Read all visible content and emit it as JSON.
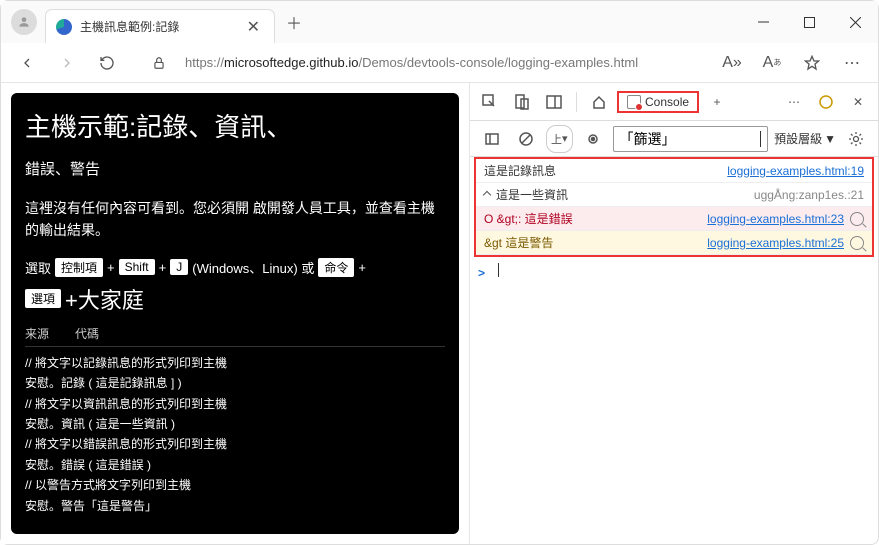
{
  "window": {
    "tab_title": "主機訊息範例:記錄",
    "url_prefix": "https://",
    "url_host": "microsoftedge.github.io",
    "url_path": "/Demos/devtools-console/logging-examples.html"
  },
  "page": {
    "h1": "主機示範:記錄、資訊、",
    "h2": "錯誤、警告",
    "para": "這裡沒有任何內容可看到。您必須開 啟開發人員工具，並查看主機的輸出結果。",
    "select_label": "選取",
    "kbd_ctrl": "控制項",
    "plus": "+",
    "kbd_shift": "Shift",
    "kbd_j": "J",
    "os_label": "(Windows、Linux) 或",
    "kbd_cmd": "命令",
    "kbd_option": "選項",
    "big": "+大家庭",
    "code_head_src": "来源",
    "code_head_code": "代碼",
    "lines": [
      "將文字以記錄訊息的形式列印到主機",
      "安慰。記錄 ( 這是記錄訊息 ] )",
      "將文字以資訊訊息的形式列印到主機",
      "安慰。資訊 ( 這是一些資訊 )",
      "將文字以錯誤訊息的形式列印到主機",
      "安慰。錯誤 ( 這是錯誤 )",
      "以警告方式將文字列印到主機",
      "安慰。警告「這是警告」"
    ]
  },
  "devtools": {
    "console_label": "Console",
    "plus_label": "+",
    "top_label": "上",
    "filter_text": "「篩選」",
    "level_label": "預設層級",
    "logs": [
      {
        "type": "info",
        "msg": "這是記錄訊息",
        "src": "logging-examples.html:19",
        "link": true
      },
      {
        "type": "info",
        "msg": "這是一些資訊",
        "src": "uggÅng:zanp1es.:21",
        "link": false
      },
      {
        "type": "err",
        "msg": "O &gt;: 這是錯誤",
        "src": "logging-examples.html:23",
        "link": true
      },
      {
        "type": "warn",
        "msg": "&gt 這是警告",
        "src": "logging-examples.html:25",
        "link": true
      }
    ],
    "prompt": ">"
  }
}
